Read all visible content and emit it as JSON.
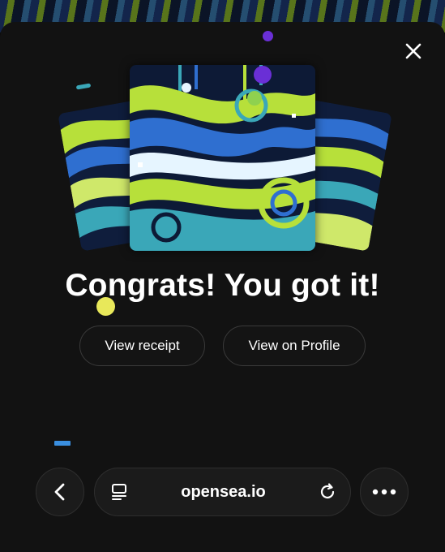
{
  "modal": {
    "headline": "Congrats! You got it!",
    "actions": {
      "receipt_label": "View receipt",
      "profile_label": "View on Profile"
    }
  },
  "browser": {
    "url": "opensea.io"
  },
  "icons": {
    "close": "close-icon",
    "back": "chevron-left-icon",
    "tabs": "tabs-icon",
    "reload": "reload-icon",
    "more": "more-icon"
  },
  "colors": {
    "modal_background": "#121212",
    "page_background": "#050505",
    "button_border": "#3a3a3a",
    "art_blue": "#1f4fa8",
    "art_green": "#b7e03a",
    "art_teal": "#3aa7b8",
    "confetti_purple": "#6a2fd6",
    "confetti_yellow": "#e8e85a"
  }
}
